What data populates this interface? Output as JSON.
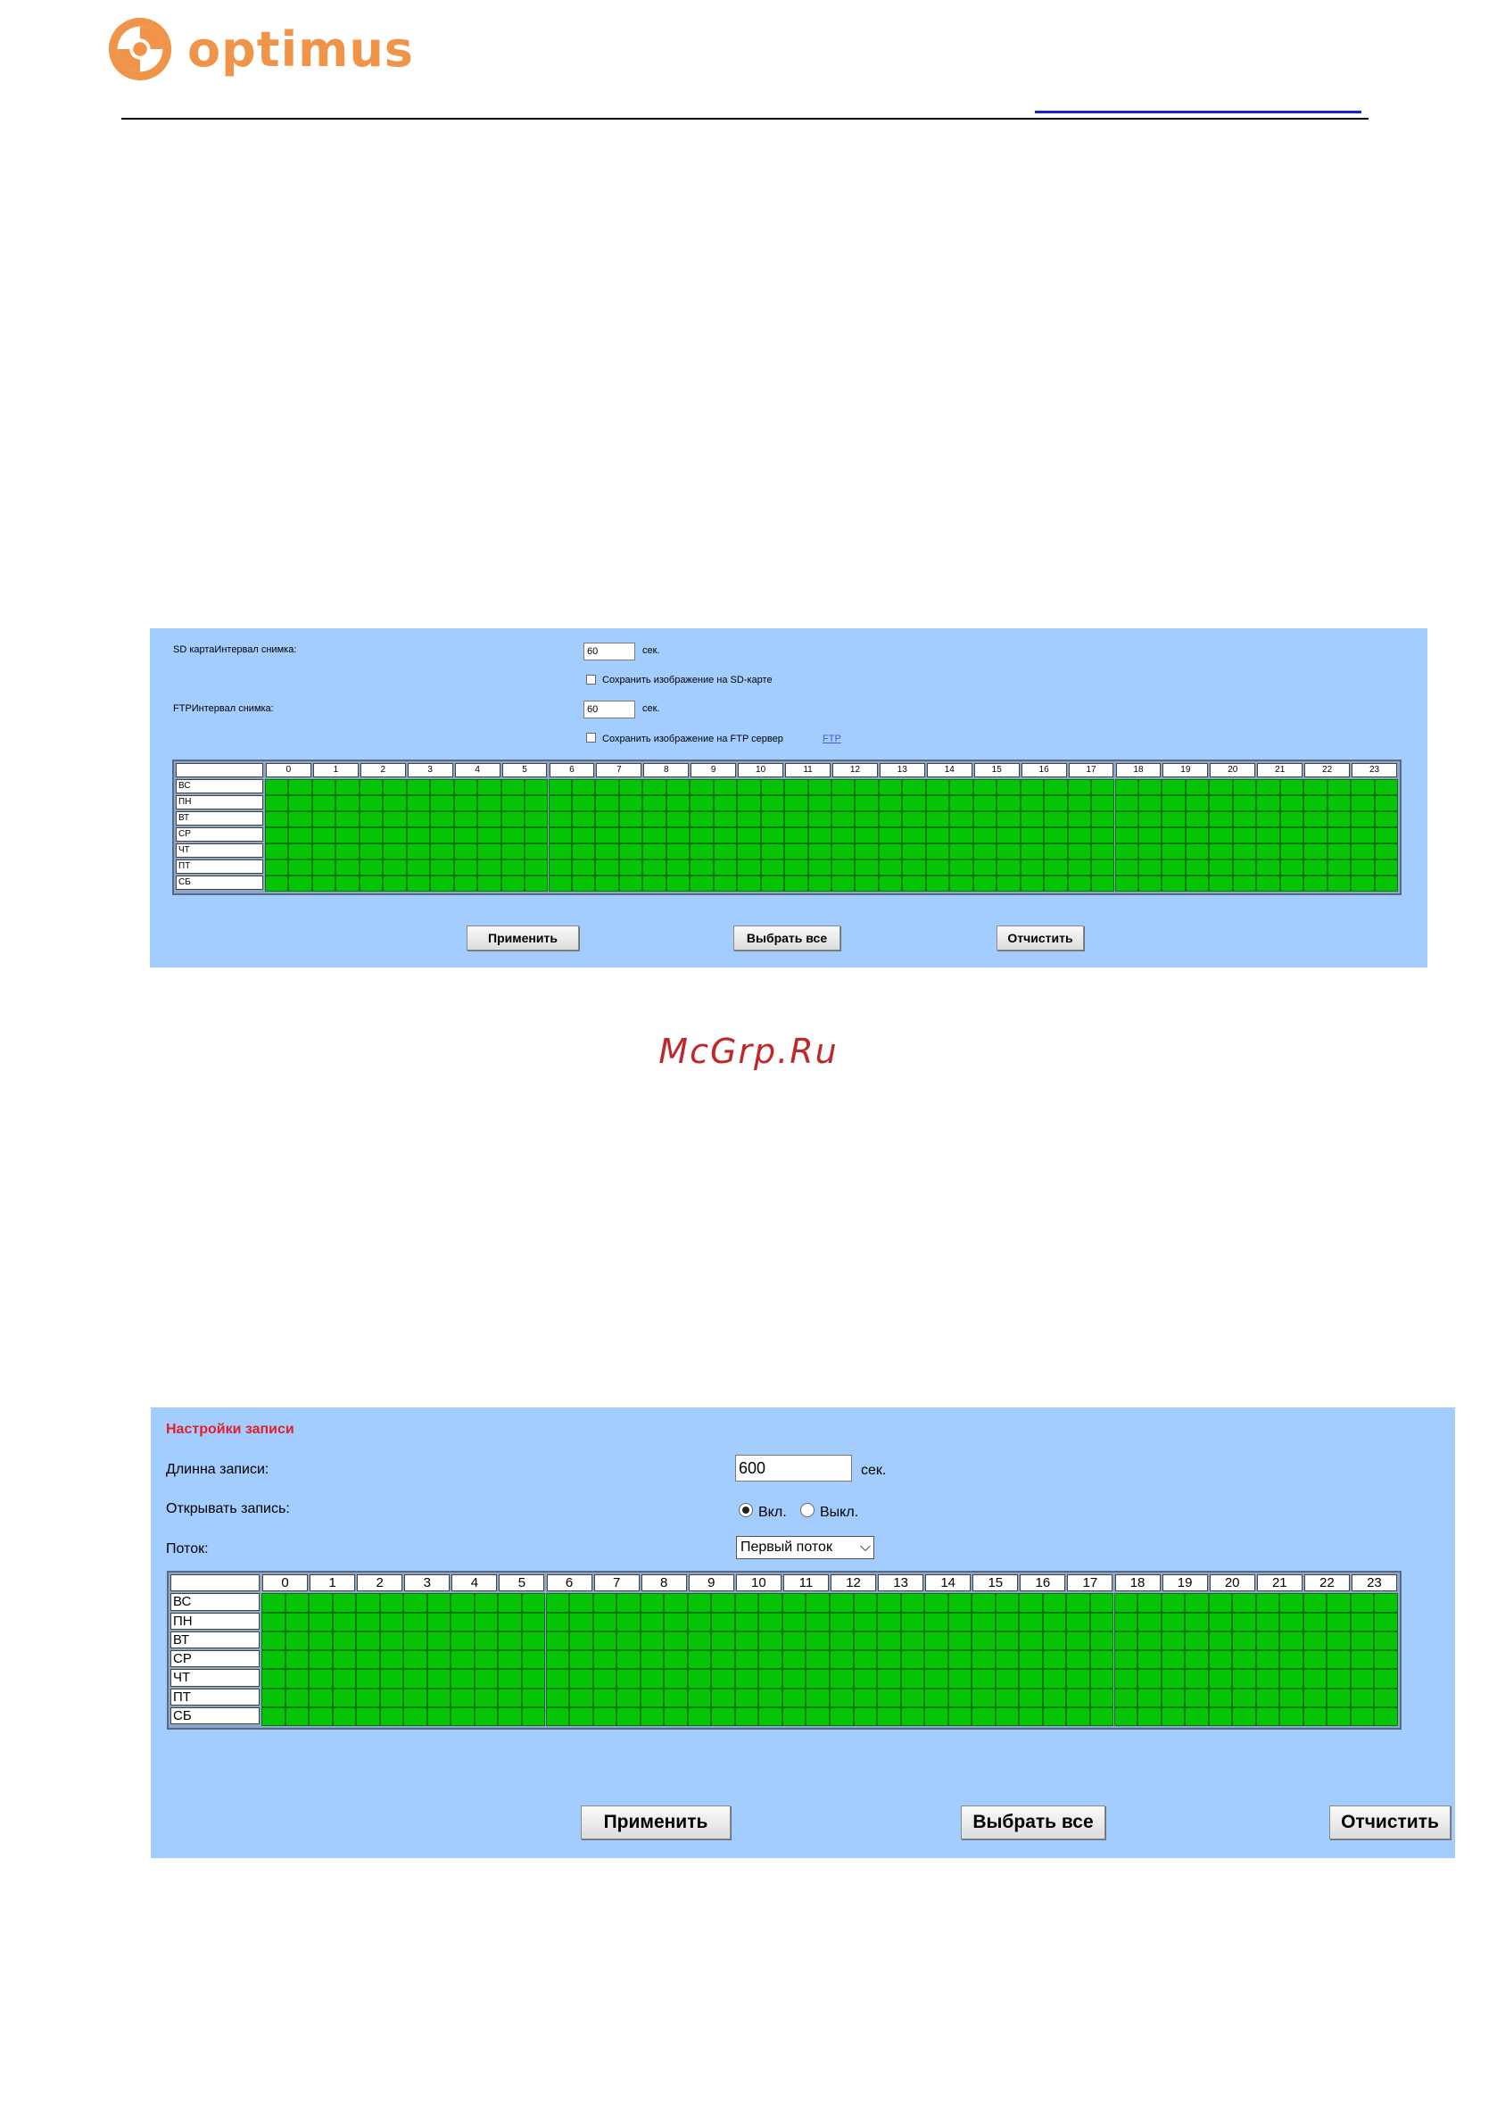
{
  "brand": {
    "name": "optimus",
    "color": "#f0944a"
  },
  "colors": {
    "panel_bg": "#a3ccff",
    "slot_active": "#06c406",
    "title_red": "#e0202a"
  },
  "schedule": {
    "hours": [
      "0",
      "1",
      "2",
      "3",
      "4",
      "5",
      "6",
      "7",
      "8",
      "9",
      "10",
      "11",
      "12",
      "13",
      "14",
      "15",
      "16",
      "17",
      "18",
      "19",
      "20",
      "21",
      "22",
      "23"
    ],
    "days": [
      "ВС",
      "ПН",
      "ВТ",
      "СР",
      "ЧТ",
      "ПТ",
      "СБ"
    ],
    "all_selected": true
  },
  "snapshot_panel": {
    "sd_label": "SD картаИнтервал снимка:",
    "sd_interval": "60",
    "sd_unit": "сек.",
    "sd_save_label": "Сохранить изображение на SD-карте",
    "ftp_label": "FTPИнтервал снимка:",
    "ftp_interval": "60",
    "ftp_unit": "сек.",
    "ftp_save_label": "Сохранить изображение на FTP сервер",
    "ftp_link": "FTP",
    "apply": "Применить",
    "select_all": "Выбрать все",
    "clear": "Отчистить"
  },
  "watermark": "McGrp.Ru",
  "record_panel": {
    "title": "Настройки записи",
    "length_label": "Длинна записи:",
    "length_value": "600",
    "length_unit": "сек.",
    "open_label": "Открывать запись:",
    "on_label": "Вкл.",
    "off_label": "Выкл.",
    "stream_label": "Поток:",
    "stream_value": "Первый поток",
    "apply": "Применить",
    "select_all": "Выбрать все",
    "clear": "Отчистить"
  }
}
